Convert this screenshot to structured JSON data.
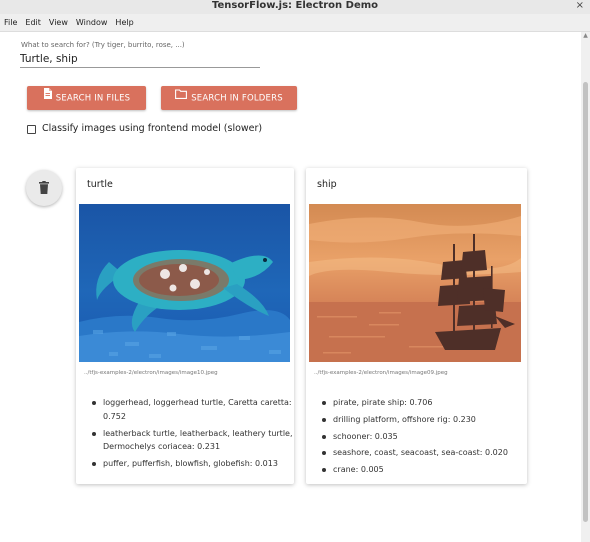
{
  "window": {
    "title": "TensorFlow.js: Electron Demo",
    "close_glyph": "×"
  },
  "menu": [
    "File",
    "Edit",
    "View",
    "Window",
    "Help"
  ],
  "search": {
    "label": "What to search for? (Try tiger, burrito, rose, ...)",
    "value": "Turtle, ship"
  },
  "buttons": {
    "search_files": "SEARCH IN FILES",
    "search_folders": "SEARCH IN FOLDERS"
  },
  "options": {
    "frontend_checkbox_label": "Classify images using frontend model (slower)",
    "frontend_checked": false
  },
  "colors": {
    "accent": "#d9715d",
    "fab": "#eaeaea"
  },
  "icons": {
    "files_button": "file-icon",
    "folders_button": "folder-icon",
    "clear_button": "trash-icon"
  },
  "results": [
    {
      "query": "turtle",
      "path": "../tfjs-examples-2/electron/images/image10.jpeg",
      "predictions": [
        "loggerhead, loggerhead turtle, Caretta caretta: 0.752",
        "leatherback turtle, leatherback, leathery turtle, Dermochelys coriacea: 0.231",
        "puffer, pufferfish, blowfish, globefish: 0.013"
      ]
    },
    {
      "query": "ship",
      "path": "../tfjs-examples-2/electron/images/image09.jpeg",
      "predictions": [
        "pirate, pirate ship: 0.706",
        "drilling platform, offshore rig: 0.230",
        "schooner: 0.035",
        "seashore, coast, seacoast, sea-coast: 0.020",
        "crane: 0.005"
      ]
    }
  ]
}
